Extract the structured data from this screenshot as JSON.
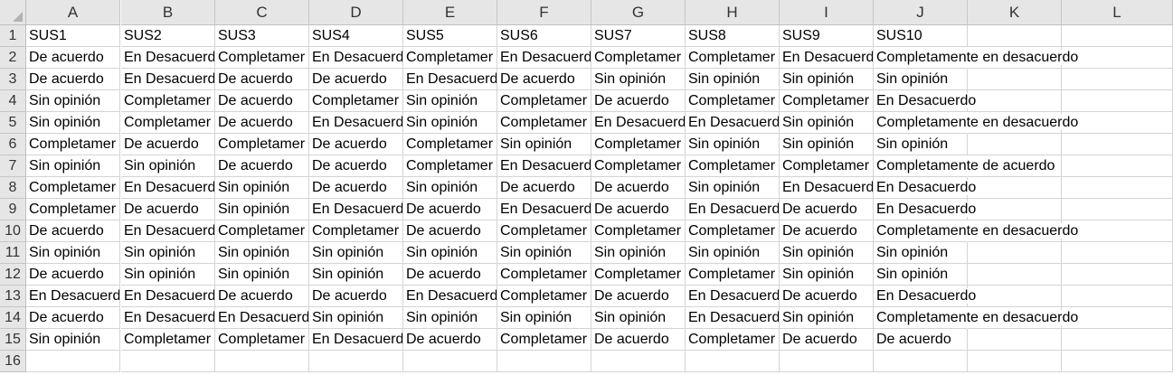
{
  "sheet": {
    "columns": [
      "A",
      "B",
      "C",
      "D",
      "E",
      "F",
      "G",
      "H",
      "I",
      "J",
      "K",
      "L"
    ],
    "rows": [
      [
        "SUS1",
        "SUS2",
        "SUS3",
        "SUS4",
        "SUS5",
        "SUS6",
        "SUS7",
        "SUS8",
        "SUS9",
        "SUS10",
        "",
        ""
      ],
      [
        "De acuerdo",
        "En Desacuerd",
        "Completamer",
        "En Desacuerd",
        "Completamer",
        "En Desacuerd",
        "Completamer",
        "Completamer",
        "En Desacuerd",
        "Completamente en desacuerdo",
        "",
        ""
      ],
      [
        "De acuerdo",
        "En Desacuerd",
        "De acuerdo",
        "De acuerdo",
        "En Desacuerd",
        "De acuerdo",
        "Sin opinión",
        "Sin opinión",
        "Sin opinión",
        "Sin opinión",
        "",
        ""
      ],
      [
        "Sin opinión",
        "Completamer",
        "De acuerdo",
        "Completamer",
        "Sin opinión",
        "Completamer",
        "De acuerdo",
        "Completamer",
        "Completamer",
        "En Desacuerdo",
        "",
        ""
      ],
      [
        "Sin opinión",
        "Completamer",
        "De acuerdo",
        "En Desacuerd",
        "Sin opinión",
        "Completamer",
        "En Desacuerd",
        "En Desacuerd",
        "Sin opinión",
        "Completamente en desacuerdo",
        "",
        ""
      ],
      [
        "Completamer",
        "De acuerdo",
        "Completamer",
        "De acuerdo",
        "Completamer",
        "Sin opinión",
        "Completamer",
        "Sin opinión",
        "Sin opinión",
        "Sin opinión",
        "",
        ""
      ],
      [
        "Sin opinión",
        "Sin opinión",
        "De acuerdo",
        "De acuerdo",
        "Completamer",
        "En Desacuerd",
        "Completamer",
        "Completamer",
        "Completamer",
        "Completamente de acuerdo",
        "",
        ""
      ],
      [
        "Completamer",
        "En Desacuerd",
        "Sin opinión",
        "De acuerdo",
        "Sin opinión",
        "De acuerdo",
        "De acuerdo",
        "Sin opinión",
        "En Desacuerd",
        "En Desacuerdo",
        "",
        ""
      ],
      [
        "Completamer",
        "De acuerdo",
        "Sin opinión",
        "En Desacuerd",
        "De acuerdo",
        "En Desacuerd",
        "De acuerdo",
        "En Desacuerd",
        "De acuerdo",
        "En Desacuerdo",
        "",
        ""
      ],
      [
        "De acuerdo",
        "En Desacuerd",
        "Completamer",
        "Completamer",
        "De acuerdo",
        "Completamer",
        "Completamer",
        "Completamer",
        "De acuerdo",
        "Completamente en desacuerdo",
        "",
        ""
      ],
      [
        "Sin opinión",
        "Sin opinión",
        "Sin opinión",
        "Sin opinión",
        "Sin opinión",
        "Sin opinión",
        "Sin opinión",
        "Sin opinión",
        "Sin opinión",
        "Sin opinión",
        "",
        ""
      ],
      [
        "De acuerdo",
        "Sin opinión",
        "Sin opinión",
        "Sin opinión",
        "De acuerdo",
        "Completamer",
        "Completamer",
        "Completamer",
        "Sin opinión",
        "Sin opinión",
        "",
        ""
      ],
      [
        "En Desacuerd",
        "En Desacuerd",
        "De acuerdo",
        "De acuerdo",
        "En Desacuerd",
        "Completamer",
        "De acuerdo",
        "En Desacuerd",
        "De acuerdo",
        "En Desacuerdo",
        "",
        ""
      ],
      [
        "De acuerdo",
        "En Desacuerd",
        "En Desacuerd",
        "Sin opinión",
        "Sin opinión",
        "Sin opinión",
        "Sin opinión",
        "En Desacuerd",
        "Sin opinión",
        "Completamente en desacuerdo",
        "",
        ""
      ],
      [
        "Sin opinión",
        "Completamer",
        "Completamer",
        "En Desacuerd",
        "De acuerdo",
        "Completamer",
        "De acuerdo",
        "Completamer",
        "De acuerdo",
        "De acuerdo",
        "",
        ""
      ],
      [
        "",
        "",
        "",
        "",
        "",
        "",
        "",
        "",
        "",
        "",
        "",
        ""
      ]
    ]
  }
}
